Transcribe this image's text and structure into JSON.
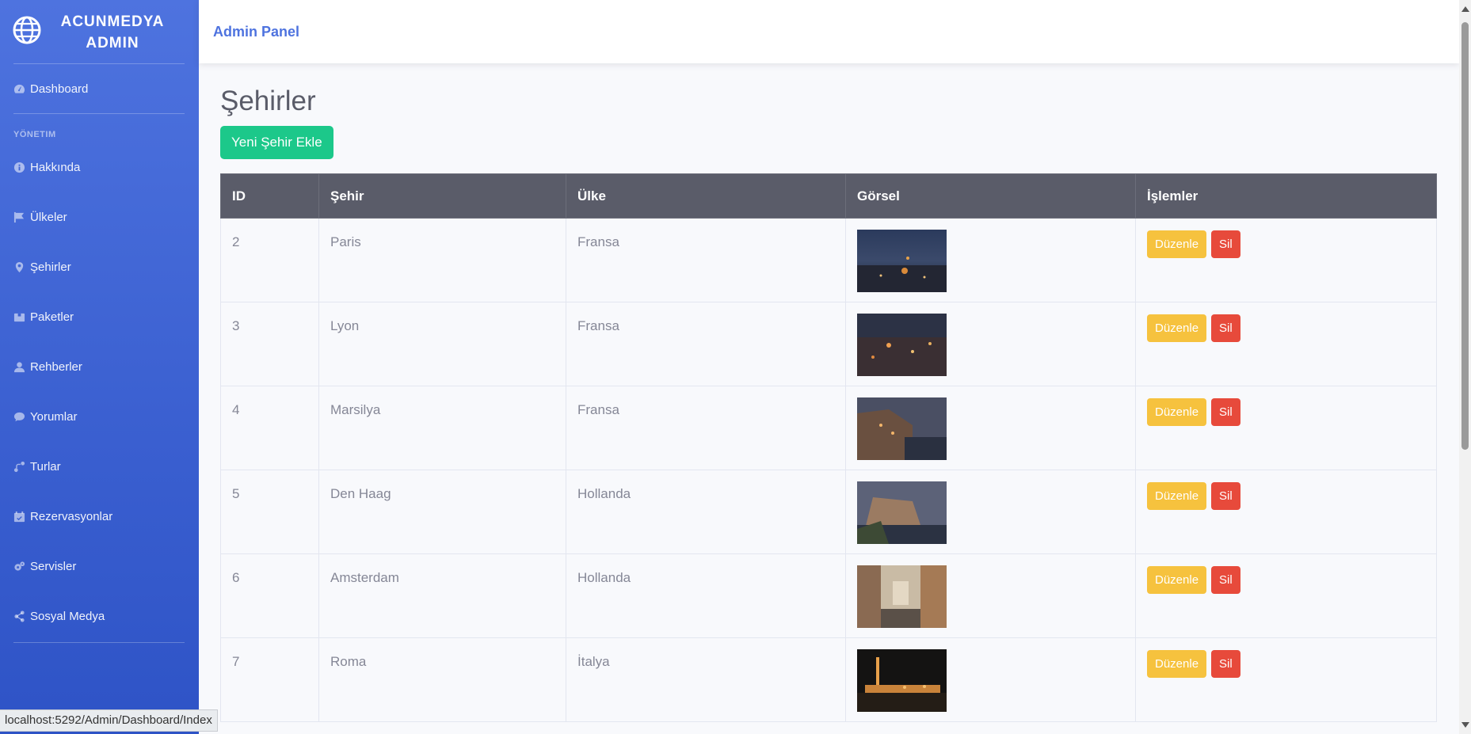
{
  "sidebar": {
    "brand": {
      "line1": "ACUNMEDYA",
      "line2": "ADMIN"
    },
    "dashboard": {
      "label": "Dashboard",
      "icon": "tachometer-icon"
    },
    "heading": "YÖNETIM",
    "items": [
      {
        "label": "Hakkında",
        "icon": "info-icon"
      },
      {
        "label": "Ülkeler",
        "icon": "flag-icon"
      },
      {
        "label": "Şehirler",
        "icon": "map-marker-icon"
      },
      {
        "label": "Paketler",
        "icon": "box-icon"
      },
      {
        "label": "Rehberler",
        "icon": "user-tie-icon"
      },
      {
        "label": "Yorumlar",
        "icon": "comment-icon"
      },
      {
        "label": "Turlar",
        "icon": "route-icon"
      },
      {
        "label": "Rezervasyonlar",
        "icon": "calendar-check-icon"
      },
      {
        "label": "Servisler",
        "icon": "cogs-icon"
      },
      {
        "label": "Sosyal Medya",
        "icon": "share-icon"
      }
    ]
  },
  "status_url": "localhost:5292/Admin/Dashboard/Index",
  "topbar": {
    "title": "Admin Panel"
  },
  "page": {
    "title": "Şehirler",
    "add_button": "Yeni Şehir Ekle"
  },
  "table": {
    "headers": [
      "ID",
      "Şehir",
      "Ülke",
      "Görsel",
      "İşlemler"
    ],
    "rows": [
      {
        "id": "2",
        "city": "Paris",
        "country": "Fransa"
      },
      {
        "id": "3",
        "city": "Lyon",
        "country": "Fransa"
      },
      {
        "id": "4",
        "city": "Marsilya",
        "country": "Fransa"
      },
      {
        "id": "5",
        "city": "Den Haag",
        "country": "Hollanda"
      },
      {
        "id": "6",
        "city": "Amsterdam",
        "country": "Hollanda"
      },
      {
        "id": "7",
        "city": "Roma",
        "country": "İtalya"
      }
    ],
    "edit_label": "Düzenle",
    "delete_label": "Sil"
  },
  "colors": {
    "sidebar": "#4e73df",
    "success": "#1cc88a",
    "warning": "#f6c23e",
    "danger": "#e74a3b",
    "table_header": "#5a5c69"
  }
}
